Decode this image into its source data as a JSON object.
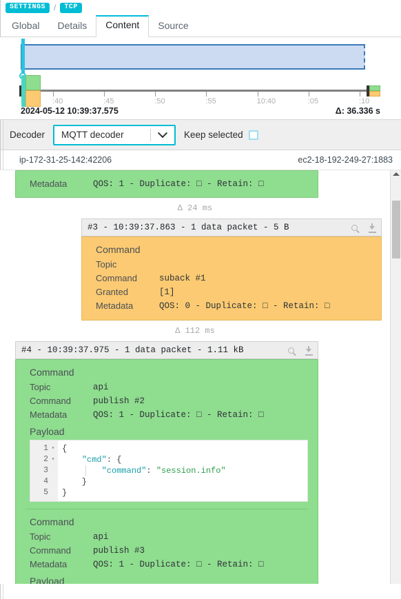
{
  "breadcrumb": {
    "items": [
      "SETTINGS",
      "TCP"
    ],
    "separator": "/"
  },
  "tabs": [
    {
      "label": "Global",
      "active": false
    },
    {
      "label": "Details",
      "active": false
    },
    {
      "label": "Content",
      "active": true
    },
    {
      "label": "Source",
      "active": false
    }
  ],
  "timeline": {
    "start_label": "2024-05-12 10:39:37.575",
    "delta_label": "Δ: 36.336 s",
    "ticks": [
      {
        "label": ":40",
        "pos_pct": 9.2
      },
      {
        "label": ":45",
        "pos_pct": 24.7
      },
      {
        "label": ":50",
        "pos_pct": 40.2
      },
      {
        "label": ":55",
        "pos_pct": 55.7
      },
      {
        "label": "10:40",
        "pos_pct": 71.2
      },
      {
        "label": ":05",
        "pos_pct": 86.7
      },
      {
        "label": ":10",
        "pos_pct": 99.9
      }
    ]
  },
  "toolbar": {
    "decoder_label": "Decoder",
    "decoder_value": "MQTT decoder",
    "keep_selected_label": "Keep selected",
    "keep_selected_checked": false
  },
  "endpoints": {
    "client": "ip-172-31-25-142:42206",
    "server": "ec2-18-192-249-27:1883"
  },
  "colors": {
    "accent": "#00bcd4",
    "outbound_block": "#8fdd8f",
    "inbound_block": "#fcca72",
    "selection_fill": "#ccdaf2",
    "selection_border": "#3a7ab8"
  },
  "stream": {
    "metadata_top": {
      "key": "Metadata",
      "value": "QOS: 1 - Duplicate: □ - Retain: □"
    },
    "delta_1": "Δ 24 ms",
    "packet_3": {
      "title": "#3 - 10:39:37.863 - 1 data packet - 5 B",
      "search_icon": "search-icon",
      "download_icon": "download-icon"
    },
    "command_suback": {
      "title": "Command",
      "rows": [
        {
          "k": "Topic",
          "v": ""
        },
        {
          "k": "Command",
          "v": "suback #1"
        },
        {
          "k": "Granted",
          "v": "[1]"
        },
        {
          "k": "Metadata",
          "v": "QOS: 0 - Duplicate: □ - Retain: □"
        }
      ]
    },
    "delta_2": "Δ 112 ms",
    "packet_4": {
      "title": "#4 - 10:39:37.975 - 1 data packet - 1.11 kB",
      "search_icon": "search-icon",
      "download_icon": "download-icon"
    },
    "command_publish2": {
      "title": "Command",
      "rows": [
        {
          "k": "Topic",
          "v": "api"
        },
        {
          "k": "Command",
          "v": "publish #2"
        },
        {
          "k": "Metadata",
          "v": "QOS: 1 - Duplicate: □ - Retain: □"
        }
      ],
      "payload_label": "Payload",
      "payload_lines": [
        {
          "num": "1",
          "fold": "▾",
          "text": "{"
        },
        {
          "num": "2",
          "fold": "▾",
          "text": "    \"cmd\": {"
        },
        {
          "num": "3",
          "fold": "",
          "text": "        \"command\": \"session.info\""
        },
        {
          "num": "4",
          "fold": "",
          "text": "    }"
        },
        {
          "num": "5",
          "fold": "",
          "text": "}"
        }
      ]
    },
    "command_publish3": {
      "title": "Command",
      "rows": [
        {
          "k": "Topic",
          "v": "api"
        },
        {
          "k": "Command",
          "v": "publish #3"
        },
        {
          "k": "Metadata",
          "v": "QOS: 1 - Duplicate: □ - Retain: □"
        }
      ],
      "payload_label": "Payload"
    }
  }
}
